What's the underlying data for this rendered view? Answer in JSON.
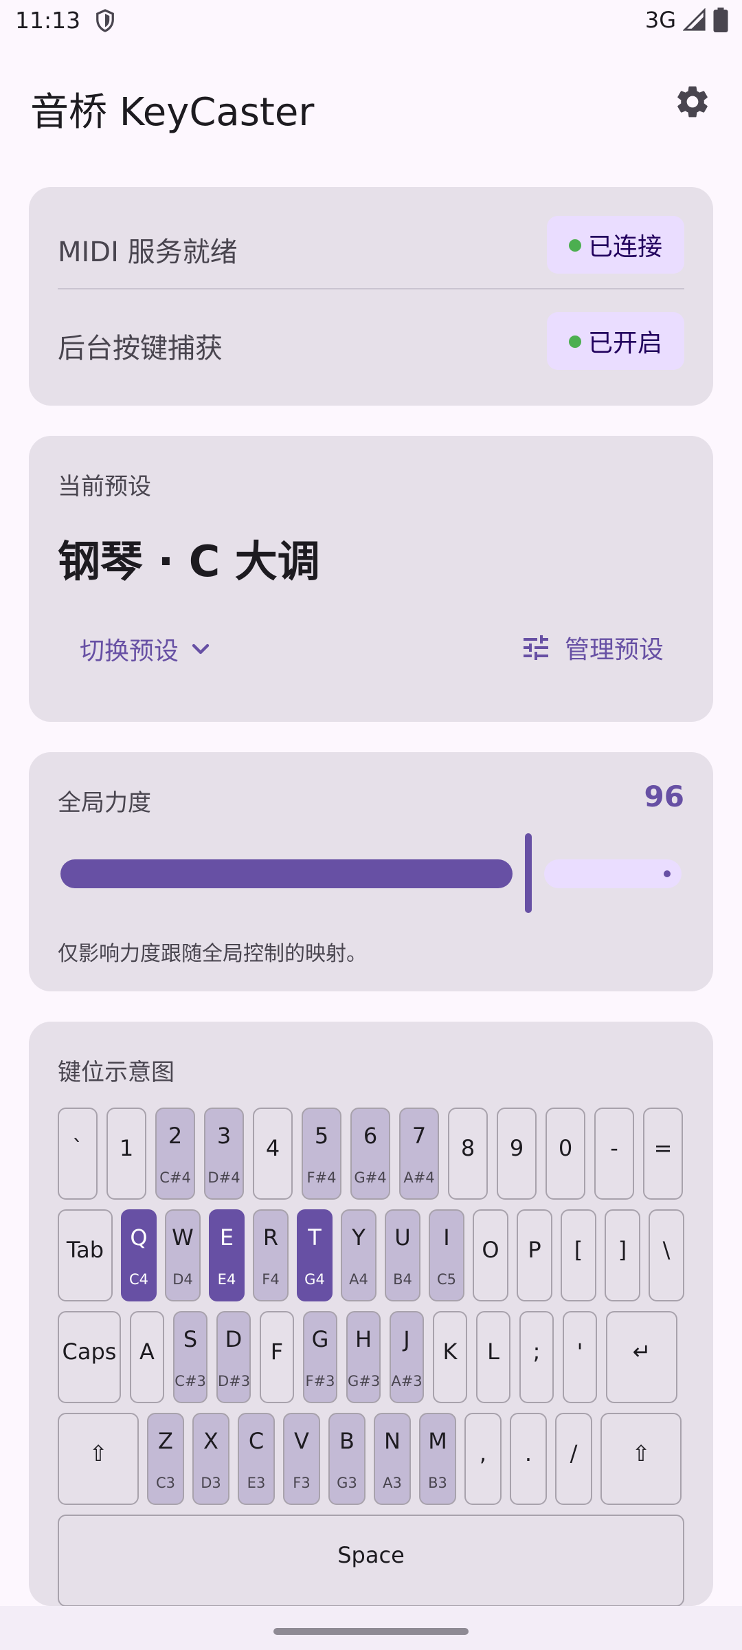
{
  "status_bar": {
    "time": "11:13",
    "network": "3G"
  },
  "app": {
    "title": "音桥 KeyCaster"
  },
  "status_card": {
    "midi_label": "MIDI 服务就绪",
    "midi_status": "已连接",
    "capture_label": "后台按键捕获",
    "capture_status": "已开启",
    "status_color": "#4CAF50"
  },
  "preset_card": {
    "label": "当前预设",
    "name": "钢琴 · C 大调",
    "switch_label": "切换预设",
    "manage_label": "管理预设"
  },
  "velocity_card": {
    "label": "全局力度",
    "value": "96",
    "level_fraction": 0.756,
    "hint": "仅影响力度跟随全局控制的映射。"
  },
  "keyboard_card": {
    "title": "键位示意图",
    "rows": [
      [
        {
          "key": "`",
          "note": ""
        },
        {
          "key": "1",
          "note": ""
        },
        {
          "key": "2",
          "note": "C#4"
        },
        {
          "key": "3",
          "note": "D#4"
        },
        {
          "key": "4",
          "note": ""
        },
        {
          "key": "5",
          "note": "F#4"
        },
        {
          "key": "6",
          "note": "G#4"
        },
        {
          "key": "7",
          "note": "A#4"
        },
        {
          "key": "8",
          "note": ""
        },
        {
          "key": "9",
          "note": ""
        },
        {
          "key": "0",
          "note": ""
        },
        {
          "key": "-",
          "note": ""
        },
        {
          "key": "=",
          "note": ""
        }
      ],
      [
        {
          "key": "Tab",
          "note": ""
        },
        {
          "key": "Q",
          "note": "C4",
          "active": true
        },
        {
          "key": "W",
          "note": "D4"
        },
        {
          "key": "E",
          "note": "E4",
          "active": true
        },
        {
          "key": "R",
          "note": "F4"
        },
        {
          "key": "T",
          "note": "G4",
          "active": true
        },
        {
          "key": "Y",
          "note": "A4"
        },
        {
          "key": "U",
          "note": "B4"
        },
        {
          "key": "I",
          "note": "C5"
        },
        {
          "key": "O",
          "note": ""
        },
        {
          "key": "P",
          "note": ""
        },
        {
          "key": "[",
          "note": ""
        },
        {
          "key": "]",
          "note": ""
        },
        {
          "key": "\\",
          "note": ""
        }
      ],
      [
        {
          "key": "Caps",
          "note": ""
        },
        {
          "key": "A",
          "note": ""
        },
        {
          "key": "S",
          "note": "C#3"
        },
        {
          "key": "D",
          "note": "D#3"
        },
        {
          "key": "F",
          "note": ""
        },
        {
          "key": "G",
          "note": "F#3"
        },
        {
          "key": "H",
          "note": "G#3"
        },
        {
          "key": "J",
          "note": "A#3"
        },
        {
          "key": "K",
          "note": ""
        },
        {
          "key": "L",
          "note": ""
        },
        {
          "key": ";",
          "note": ""
        },
        {
          "key": "'",
          "note": ""
        },
        {
          "key": "↵",
          "note": ""
        }
      ],
      [
        {
          "key": "⇧",
          "note": ""
        },
        {
          "key": "Z",
          "note": "C3"
        },
        {
          "key": "X",
          "note": "D3"
        },
        {
          "key": "C",
          "note": "E3"
        },
        {
          "key": "V",
          "note": "F3"
        },
        {
          "key": "B",
          "note": "G3"
        },
        {
          "key": "N",
          "note": "A3"
        },
        {
          "key": "M",
          "note": "B3"
        },
        {
          "key": ",",
          "note": ""
        },
        {
          "key": ".",
          "note": ""
        },
        {
          "key": "/",
          "note": ""
        },
        {
          "key": "⇧",
          "note": ""
        }
      ],
      [
        {
          "key": "Space",
          "note": ""
        }
      ]
    ]
  },
  "colors": {
    "accent": "#6750A4",
    "card": "#E6E0E9",
    "mapped_key": "#C3BAD5",
    "pill": "#EADDFF"
  }
}
